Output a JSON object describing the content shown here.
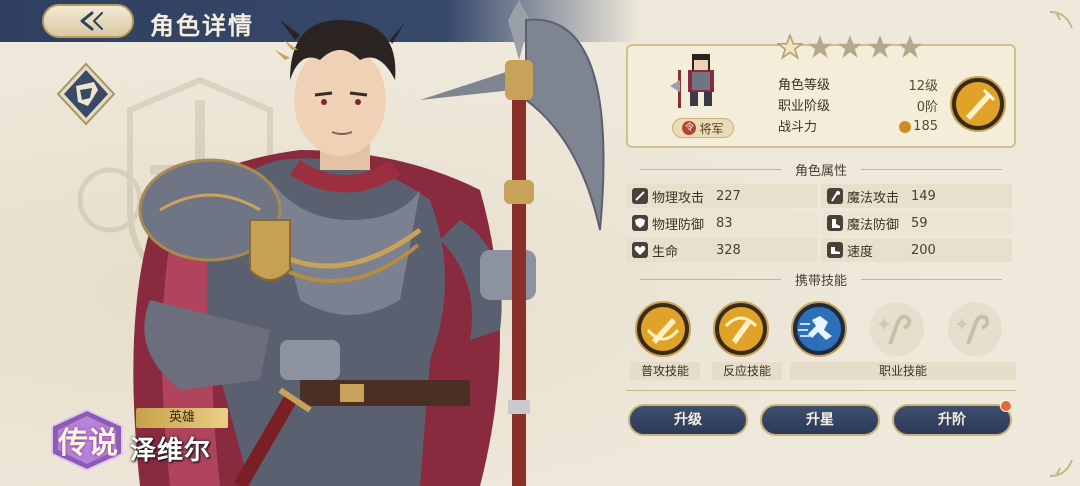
{
  "header": {
    "title": "角色详情",
    "back_icon": "back-arrow-icon"
  },
  "hero": {
    "rarity": "传说",
    "role_tag": "英雄",
    "name": "泽维尔",
    "class_emblem_icon": "guard-class-icon"
  },
  "panel": {
    "stars_filled": 1,
    "stars_total": 5,
    "rank_badge": "将军",
    "rank_icon_char": "令",
    "info": [
      {
        "label": "角色等级",
        "value": "12级"
      },
      {
        "label": "职业阶级",
        "value": "0阶"
      },
      {
        "label": "战斗力",
        "value": "185"
      }
    ],
    "attributes_title": "角色属性",
    "attributes": [
      {
        "left": {
          "label": "物理攻击",
          "value": "227",
          "icon": "sword-icon"
        },
        "right": {
          "label": "魔法攻击",
          "value": "149",
          "icon": "staff-icon"
        }
      },
      {
        "left": {
          "label": "物理防御",
          "value": "83",
          "icon": "shield-icon"
        },
        "right": {
          "label": "魔法防御",
          "value": "59",
          "icon": "magic-boot-icon"
        }
      },
      {
        "left": {
          "label": "生命",
          "value": "328",
          "icon": "heart-icon"
        },
        "right": {
          "label": "速度",
          "value": "200",
          "icon": "boot-icon"
        }
      }
    ],
    "skills_title": "携带技能",
    "skill_labels": {
      "normal": "普攻技能",
      "reaction": "反应技能",
      "class": "职业技能"
    },
    "actions": {
      "upgrade": "升级",
      "star_up": "升星",
      "advance": "升阶"
    }
  },
  "colors": {
    "navy": "#2f3f5f",
    "gold": "#c9b47c",
    "parchment": "#efe9dc"
  }
}
